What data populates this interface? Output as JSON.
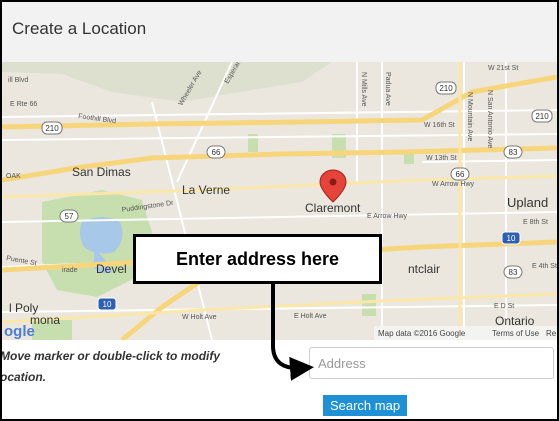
{
  "window": {
    "title": "Create a Location"
  },
  "map": {
    "place_labels": {
      "san_dimas": "San Dimas",
      "la_verne": "La Verne",
      "claremont": "Claremont",
      "upland": "Upland",
      "montclair": "ntclair",
      "ontario": "Ontario",
      "pomona": "mona",
      "poly": "l Poly",
      "devel": "Devel"
    },
    "street_labels": {
      "w21st": "W 21st St",
      "hill_blvd": "ill Blvd",
      "e_rte66": "E Rte 66",
      "foothill": "Foothill Blvd",
      "w16th": "W 16th St",
      "w13th": "W 13th St",
      "w_arrow": "W Arrow Hwy",
      "e_arrow": "E Arrow Hwy",
      "e8th": "E 8th St",
      "e4th": "E 4th St",
      "eds": "E D St",
      "w_holt": "W Holt Ave",
      "e_holt": "E Holt Ave",
      "puddingstone": "Puddingstone Dr",
      "wheeler": "Wheeler Ave",
      "esperanza": "Esperanza Dr",
      "n_mills": "N Mills Ave",
      "padua": "Padua Ave",
      "n_mountain": "N Mountain Ave",
      "n_san_antonio": "N San Antonio Ave",
      "puente": "Puente St",
      "oak": "OAK",
      "fairplex": "irade"
    },
    "shields": {
      "i210": "210",
      "i210b": "210",
      "i210c": "210",
      "r66": "66",
      "r66b": "66",
      "r83": "83",
      "r83b": "83",
      "r57": "57",
      "i10": "10",
      "i10b": "10"
    },
    "google_logo": "ogle",
    "attribution": "Map data ©2016 Google",
    "terms": "Terms of Use",
    "report": "Re"
  },
  "callout": {
    "text": "Enter address here"
  },
  "form": {
    "instructions_line1": "Move marker or double-click to modify",
    "instructions_line2": "ocation.",
    "address_placeholder": "Address",
    "search_button": "Search map"
  }
}
